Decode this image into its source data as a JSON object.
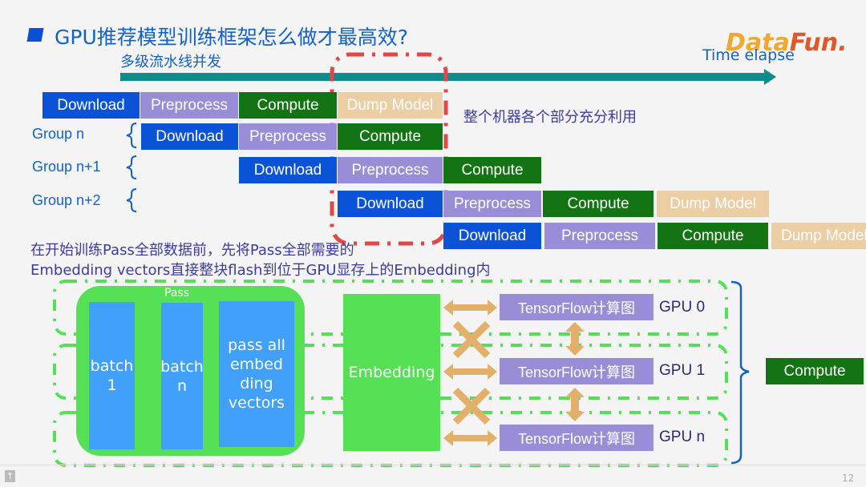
{
  "header": {
    "title": "GPU推荐模型训练框架怎么做才最高效?",
    "subtitle": "多级流水线并发",
    "time_label": "Time elapse",
    "logo": {
      "part1": "Data",
      "part2": "Fun."
    }
  },
  "pipeline": {
    "stages": {
      "download": "Download",
      "preprocess": "Preprocess",
      "compute": "Compute",
      "dump": "Dump Model"
    },
    "groups": [
      "Group n",
      "Group n+1",
      "Group n+2"
    ],
    "rows": [
      [
        "Download",
        "Preprocess",
        "Compute",
        "Dump Model"
      ],
      [
        "Download",
        "Preprocess",
        "Compute"
      ],
      [
        "Download",
        "Preprocess",
        "Compute"
      ],
      [
        "Download",
        "Preprocess",
        "Compute",
        "Dump Model"
      ],
      [
        "Download",
        "Preprocess",
        "Compute",
        "Dump Model"
      ]
    ],
    "utilization_note": "整个机器各个部分充分利用"
  },
  "embedding_section": {
    "note_line1": "在开始训练Pass全部数据前，先将Pass全部需要的",
    "note_line2": "Embedding vectors直接整块flash到位于GPU显存上的Embedding内",
    "pass_label": "Pass",
    "batch1": "batch 1",
    "batchn": "batch n",
    "pass_all": "pass all embed ding vectors",
    "embedding": "Embedding",
    "tf_graph": "TensorFlow计算图",
    "gpus": [
      "GPU 0",
      "GPU 1",
      "GPU n"
    ],
    "compute": "Compute"
  },
  "colors": {
    "download": "#0b53d6",
    "preprocess": "#9a8dd8",
    "compute": "#137413",
    "dump": "#ecceA4",
    "accent_green": "#56e055",
    "batch_blue": "#40a0fa",
    "red_dash": "#e04848",
    "teal_arrow": "#0e8b8b"
  },
  "footer": {
    "page_number": "12"
  }
}
